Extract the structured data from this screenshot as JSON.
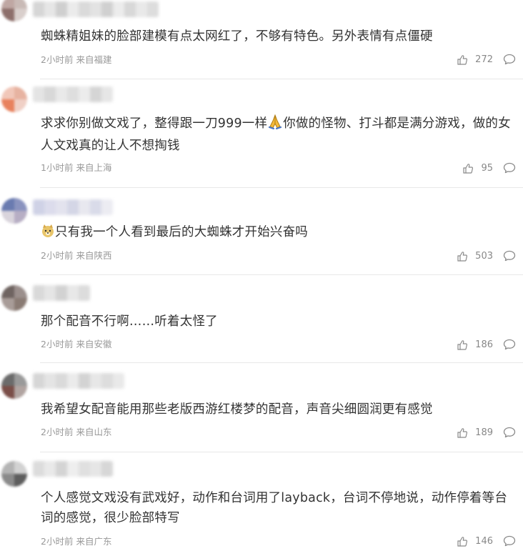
{
  "comments": [
    {
      "text": "蜘蛛精姐妹的脸部建模有点太网红了，不够有特色。另外表情有点僵硬",
      "time": "2小时前",
      "location": "来自福建",
      "likes": "272",
      "avatar_colors": [
        "#bfa7a3",
        "#c9bab6",
        "#8d6f6b",
        "#d9cfcc"
      ],
      "name_colors": [
        "#d6d6d6",
        "#e6e6e6",
        "#cfcfcf",
        "#ebebeb",
        "#dadada",
        "#e3e3e3",
        "#d0d0d0",
        "#ececec",
        "#d8d8d8",
        "#e9e9e9",
        "#dddddd"
      ]
    },
    {
      "text_before_emoji": "求求你别做文戏了，整得跟一刀999一样",
      "emoji": "praying-hands",
      "text_after_emoji": "你做的怪物、打斗都是满分游戏，做的女人文戏真的让人不想掏钱",
      "time": "1小时前",
      "location": "来自上海",
      "likes": "95",
      "avatar_colors": [
        "#f1c7b9",
        "#e7b3a1",
        "#e8825e",
        "#f0d0c6"
      ],
      "name_colors": [
        "#e4e4e4",
        "#d8d8d8",
        "#e9e9e9",
        "#dedede",
        "#ececec",
        "#d5d5d5",
        "#e6e6e6"
      ]
    },
    {
      "emoji": "doge",
      "text_after_emoji": "只有我一个人看到最后的大蜘蛛才开始兴奋吗",
      "time": "2小时前",
      "location": "来自陕西",
      "likes": "503",
      "avatar_colors": [
        "#6a7bb0",
        "#8a93bf",
        "#d9d4dc",
        "#b7aec4"
      ],
      "name_colors": [
        "#cfd2e6",
        "#dcdcec",
        "#e3e3ee",
        "#d4d6e6",
        "#e8e8ef",
        "#d9dbe9",
        "#ececf2"
      ]
    },
    {
      "text": "那个配音不行啊……听着太怪了",
      "time": "2小时前",
      "location": "来自安徽",
      "likes": "186",
      "avatar_colors": [
        "#6f6461",
        "#9b8f8c",
        "#a89c98",
        "#8a7b74"
      ],
      "name_colors": [
        "#d9d9d9",
        "#e5e5e5",
        "#d2d2d2",
        "#e8e8e8",
        "#dcdcdc"
      ]
    },
    {
      "text": "我希望女配音能用那些老版西游红楼梦的配音，声音尖细圆润更有感觉",
      "time": "2小时前",
      "location": "来自山东",
      "likes": "189",
      "avatar_colors": [
        "#6b6b6b",
        "#9a9a9a",
        "#7a4e48",
        "#b1a4a1"
      ],
      "name_colors": [
        "#d6d6d6",
        "#e4e4e4",
        "#dadada",
        "#ebebeb",
        "#d3d3d3",
        "#e7e7e7",
        "#dddddd",
        "#e9e9e9"
      ]
    },
    {
      "text": "个人感觉文戏没有武戏好，动作和台词用了layback，台词不停地说，动作停着等台词的感觉，很少脸部特写",
      "time": "2小时前",
      "location": "来自广东",
      "likes": "146",
      "avatar_colors": [
        "#b4b4b4",
        "#d2d2d2",
        "#8a8a8a",
        "#5e5e5e"
      ],
      "name_colors": [
        "#dcdcdc",
        "#e9e9e9",
        "#d4d4d4",
        "#eeeeee",
        "#e0e0e0",
        "#e6e6e6",
        "#d7d7d7"
      ]
    }
  ],
  "icons": {
    "like": "thumbs-up-icon",
    "reply": "comment-bubble-icon"
  },
  "colors": {
    "text": "#333333",
    "meta": "#999999",
    "divider": "#e8e8e8"
  }
}
